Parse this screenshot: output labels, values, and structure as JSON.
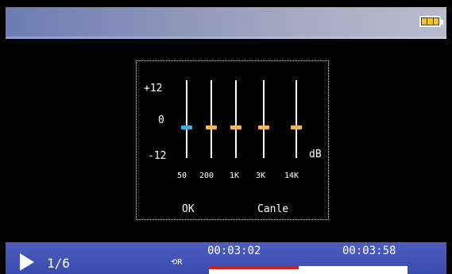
{
  "battery": {
    "icon": "battery-full-icon",
    "color": "#f3c62a"
  },
  "equalizer": {
    "levels": {
      "top": "+12",
      "mid": "0",
      "bottom": "-12"
    },
    "unit": "dB",
    "bands": [
      {
        "label": "50",
        "thumb_color": "#41a9e0"
      },
      {
        "label": "200",
        "thumb_color": "#f2b55c"
      },
      {
        "label": "1K",
        "thumb_color": "#f2b55c"
      },
      {
        "label": "3K",
        "thumb_color": "#f2b55c"
      },
      {
        "label": "14K",
        "thumb_color": "#f2b55c"
      }
    ],
    "ok_label": "OK",
    "cancel_label": "Canle"
  },
  "player": {
    "track_index": "1/6",
    "repeat_icon": "repeat-icon",
    "elapsed": "00:03:02",
    "total": "00:03:58",
    "progress_fraction": 0.45
  }
}
